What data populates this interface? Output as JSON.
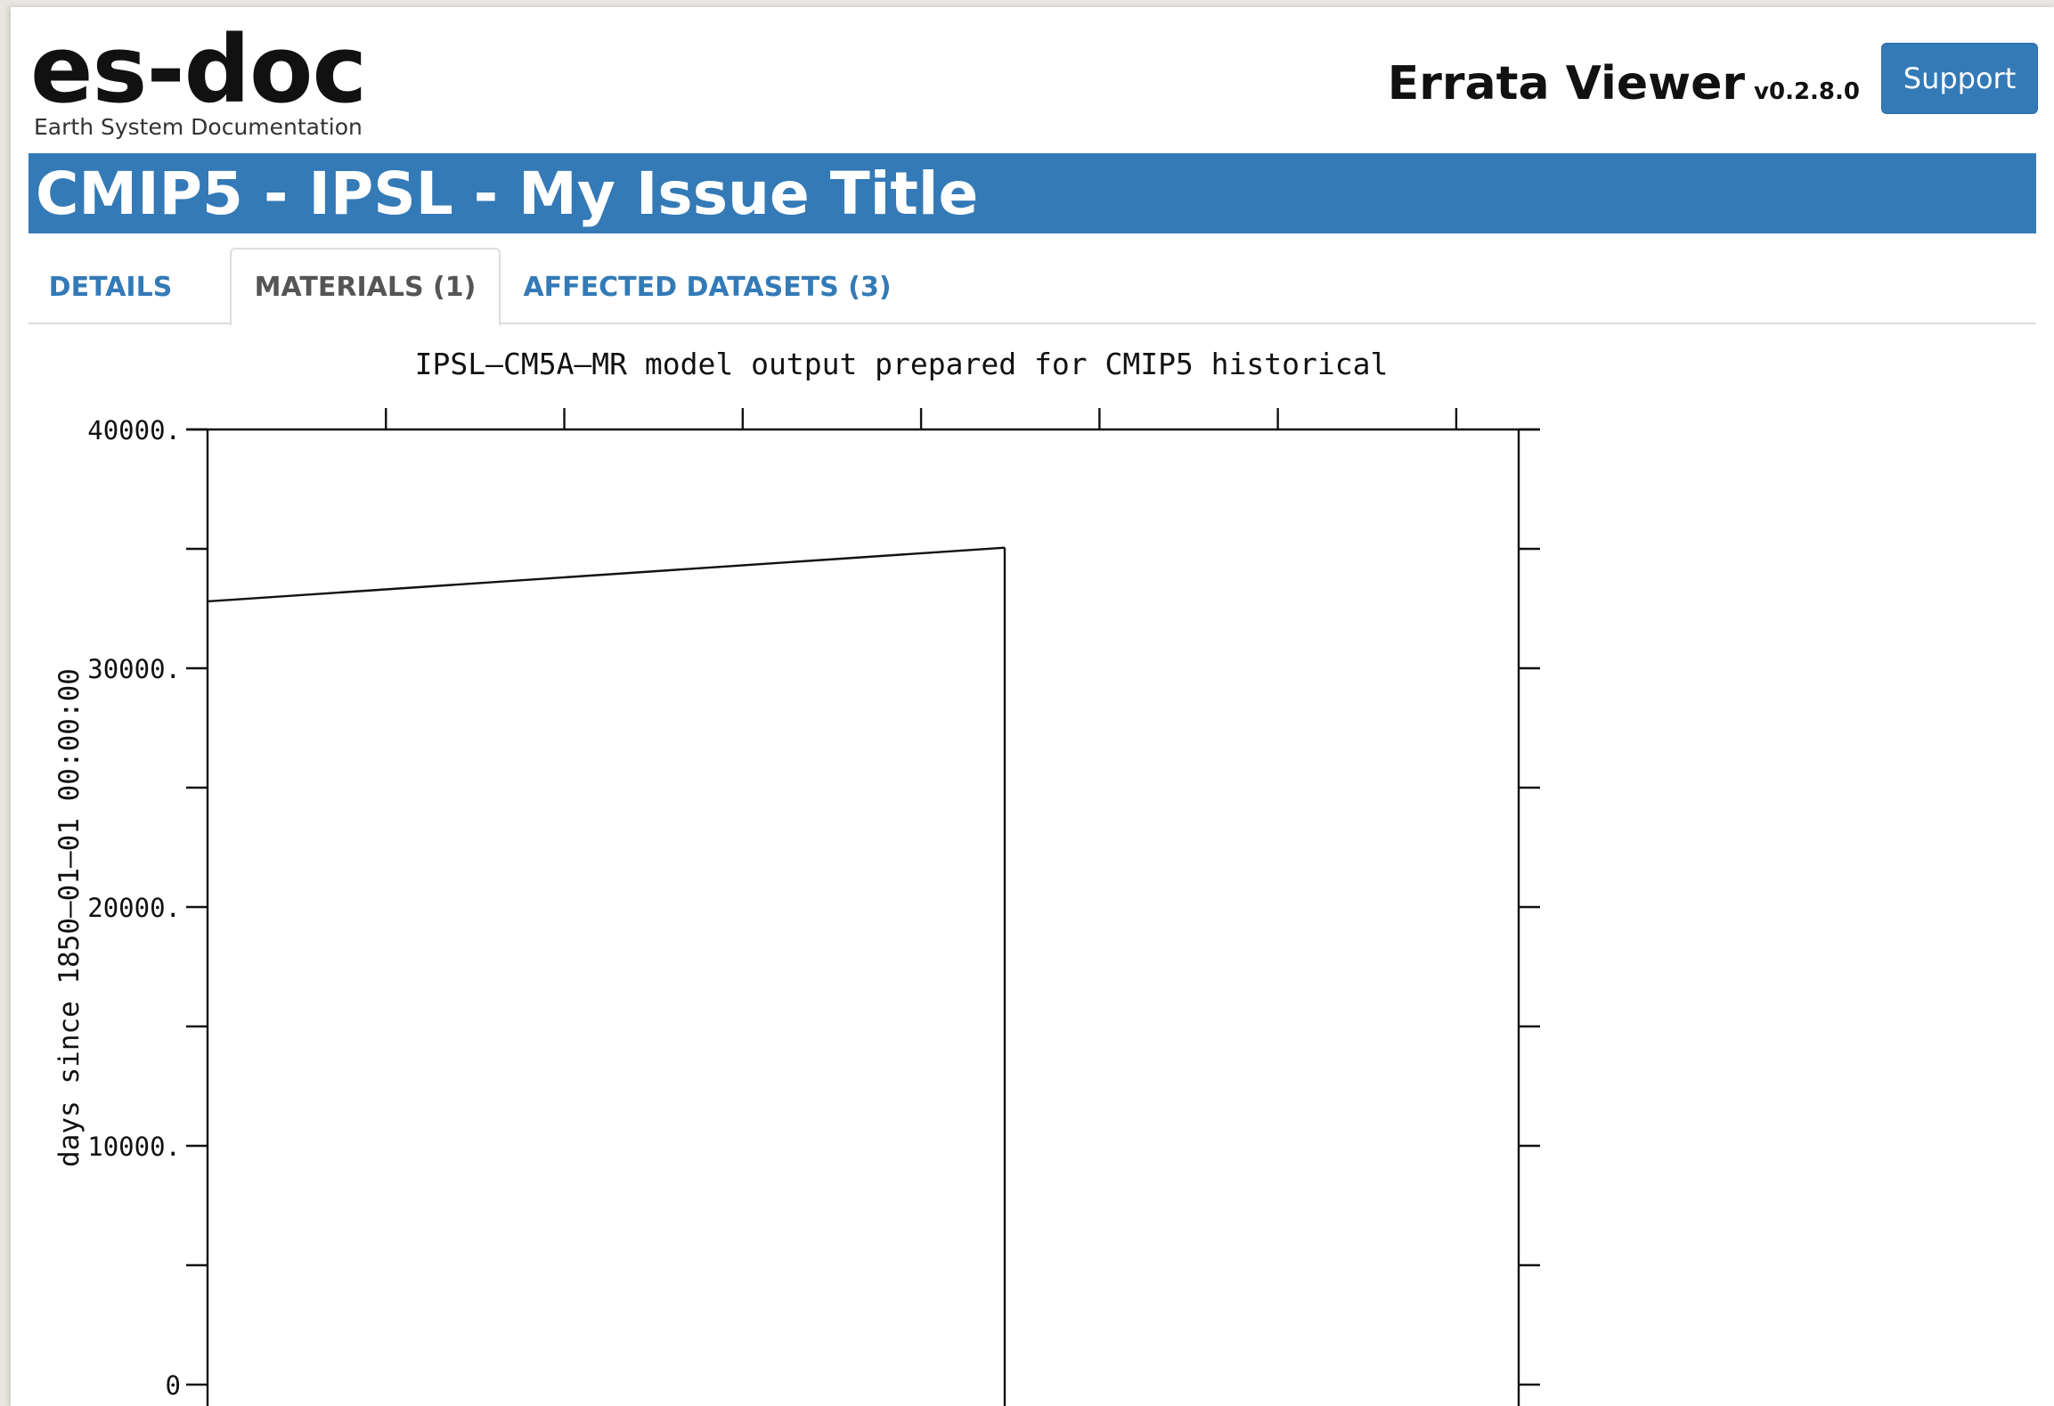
{
  "header": {
    "logo_text": "es-doc",
    "logo_subtitle": "Earth System Documentation",
    "app_title": "Errata Viewer",
    "version": "v0.2.8.0",
    "support_label": "Support"
  },
  "issue": {
    "title": "CMIP5 - IPSL - My Issue Title"
  },
  "tabs": [
    {
      "label": "DETAILS",
      "active": false
    },
    {
      "label": "MATERIALS (1)",
      "active": true
    },
    {
      "label": "AFFECTED DATASETS (3)",
      "active": false
    }
  ],
  "colors": {
    "accent": "#337ab7",
    "tab_border": "#dddddd"
  },
  "chart_data": {
    "type": "line",
    "title": "IPSL—CM5A—MR model output prepared for CMIP5 historical",
    "ylabel": "days since 1850–01–01 00:00:00",
    "xlabel": "",
    "ylim": [
      0,
      40000
    ],
    "yticks": [
      {
        "value": 40000,
        "label": "40000."
      },
      {
        "value": 30000,
        "label": "30000."
      },
      {
        "value": 20000,
        "label": "20000."
      },
      {
        "value": 10000,
        "label": "10000."
      },
      {
        "value": 0,
        "label": "0"
      }
    ],
    "y_minor_ticks": [
      35000,
      25000,
      15000,
      5000
    ],
    "x_tick_count": 7,
    "grid": false,
    "series": [
      {
        "values": [
          32800,
          35050
        ]
      }
    ],
    "drop_to_axis_at_end": true
  }
}
